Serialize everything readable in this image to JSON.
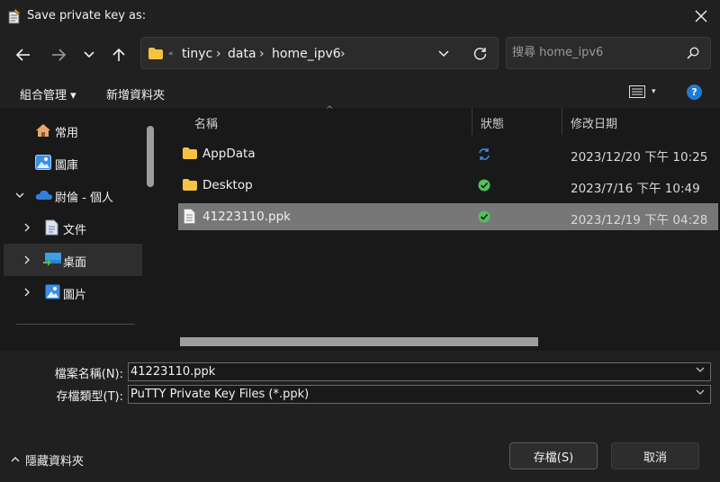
{
  "window": {
    "title": "Save private key as:"
  },
  "address": {
    "ellipsis": "«",
    "crumbs": [
      "tinyc",
      "data",
      "home_ipv6"
    ],
    "separator": "›"
  },
  "search": {
    "placeholder": "搜尋 home_ipv6"
  },
  "toolbar": {
    "organize": "組合管理 ▾",
    "new_folder": "新增資料夾",
    "view_caret": "▾",
    "help": "?"
  },
  "nav": {
    "items": [
      {
        "label": "常用"
      },
      {
        "label": "圖庫"
      },
      {
        "label": "尉倫 - 個人"
      },
      {
        "label": "文件"
      },
      {
        "label": "桌面"
      },
      {
        "label": "圖片"
      }
    ]
  },
  "columns": {
    "name": "名稱",
    "status": "狀態",
    "modified": "修改日期",
    "sort_indicator": "^"
  },
  "files": [
    {
      "name": "AppData",
      "date": "2023/12/20 下午 10:25",
      "icon": "folder-icon",
      "status": "sync-icon"
    },
    {
      "name": "Desktop",
      "date": "2023/7/16 下午 10:49",
      "icon": "folder-icon",
      "status": "check-icon"
    },
    {
      "name": "41223110.ppk",
      "date": "2023/12/19 下午 04:28",
      "icon": "file-icon",
      "status": "check-icon"
    }
  ],
  "form": {
    "filename_label": "檔案名稱(N):",
    "filename_value": "41223110.ppk",
    "filetype_label": "存檔類型(T):",
    "filetype_value": "PuTTY Private Key Files (*.ppk)"
  },
  "footer": {
    "hide_folders": "隱藏資料夾",
    "save": "存檔(S)",
    "cancel": "取消"
  },
  "colors": {
    "accent": "#1f7ad6",
    "folder": "#f5c242",
    "check": "#52c25a",
    "selected_row": "#777777"
  }
}
